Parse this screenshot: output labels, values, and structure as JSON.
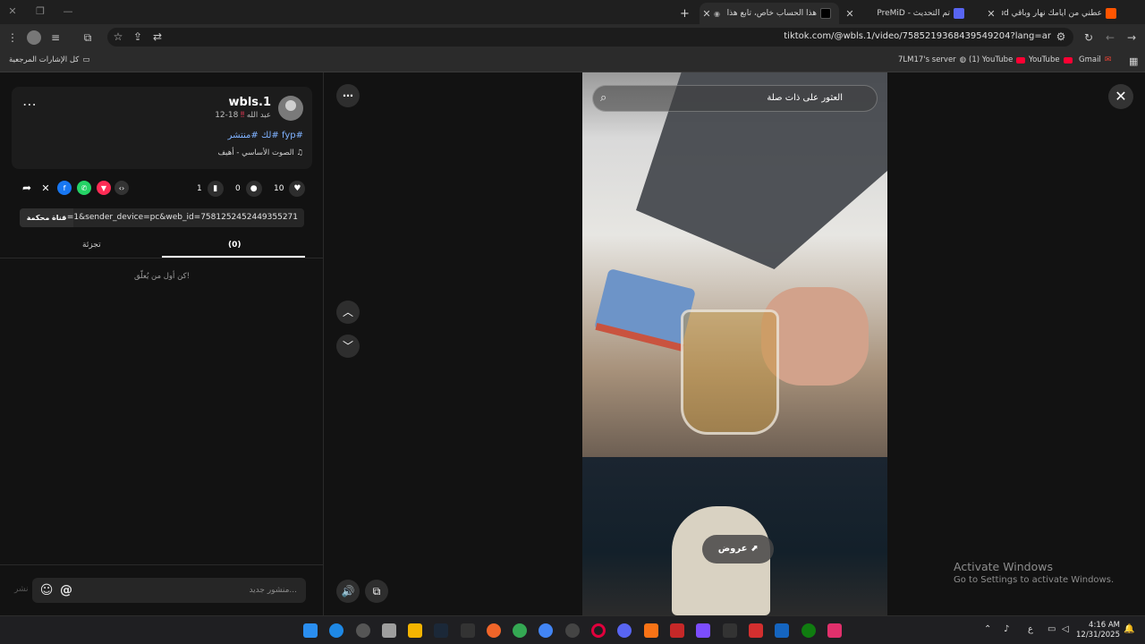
{
  "browser": {
    "tabs": [
      {
        "title": "عطني من أيامك نهار وباقي Cloud"
      },
      {
        "title": "تم التحديث - PreMiD"
      },
      {
        "title": "هذا الحساب خاص، تابع هذا ال"
      }
    ],
    "new_tab_symbol": "+",
    "url": "tiktok.com/@wbls.1/video/7585219368439549204?lang=ar",
    "bookmarks": [
      {
        "label": "كل الإشارات المرجعية"
      },
      {
        "label": "7LM17's server"
      },
      {
        "label": "(1) YouTube"
      },
      {
        "label": "YouTube"
      },
      {
        "label": "Gmail"
      }
    ]
  },
  "post": {
    "username": "wbls.1",
    "display_name": "عبد الله",
    "date": "12-18",
    "hashtags": "#fyp #لك #منتشر",
    "sound": "الصوت الأساسي - أهيف",
    "likes": "10",
    "comments": "0",
    "saves": "1",
    "link_text": "…=1&sender_device=pc&web_id=7581252452449355271",
    "copy_button_label": "قناة محكمة"
  },
  "tabs2": {
    "comments_label": "(0)",
    "other_label": "تجزئة"
  },
  "empty_state": "كن أول من يُعلّق!",
  "composer": {
    "placeholder": "منشور جديد...",
    "at_symbol": "@",
    "post_label": "نشر"
  },
  "video": {
    "search_text": "العثور على ذات صلة",
    "offers_label": "عروض"
  },
  "watermark": {
    "line1": "Activate Windows",
    "line2": "Go to Settings to activate Windows."
  },
  "taskbar": {
    "time": "4:16 AM",
    "date": "12/31/2025",
    "lang": "ع"
  },
  "colors": {
    "accent_link": "#7fb2ff",
    "youtube_red": "#ff0033"
  }
}
